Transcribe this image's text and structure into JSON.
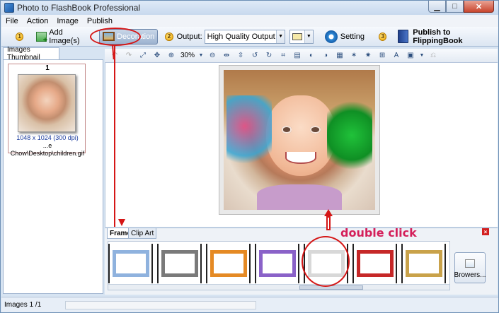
{
  "window": {
    "title": "Photo to FlashBook Professional"
  },
  "menu": [
    "File",
    "Action",
    "Image",
    "Publish"
  ],
  "toolbar": {
    "step1": "1",
    "add_images": "Add Image(s)",
    "decoration": "Decoration",
    "step2": "2",
    "output_label": "Output:",
    "output_value": "High Quality Output",
    "setting": "Setting",
    "step3": "3",
    "publish": "Publish to FlippingBook"
  },
  "left": {
    "tab": "Images Thumbnail",
    "thumb_number": "1",
    "thumb_dims": "1048 x 1024 (300 dpi)",
    "thumb_path": "...e Chow\\Desktop\\children.gif"
  },
  "editor": {
    "zoom": "30%"
  },
  "frames_panel": {
    "tabs": [
      "Frame",
      "Clip Art"
    ],
    "browse_label": "Browers...",
    "frames": [
      {
        "name": "frame-blue-dotted",
        "color": "#8fb2de"
      },
      {
        "name": "frame-gray-soft",
        "color": "#7a7a7a"
      },
      {
        "name": "frame-orange",
        "color": "#e58a24"
      },
      {
        "name": "frame-rainbow",
        "color": "#8a62c8"
      },
      {
        "name": "frame-white-haze",
        "color": "#d8d8d8"
      },
      {
        "name": "frame-red-dots",
        "color": "#c62828"
      },
      {
        "name": "frame-gold-dots",
        "color": "#c9a24a"
      }
    ]
  },
  "annotation": {
    "text": "double click"
  },
  "status": {
    "images": "Images 1 /1"
  }
}
